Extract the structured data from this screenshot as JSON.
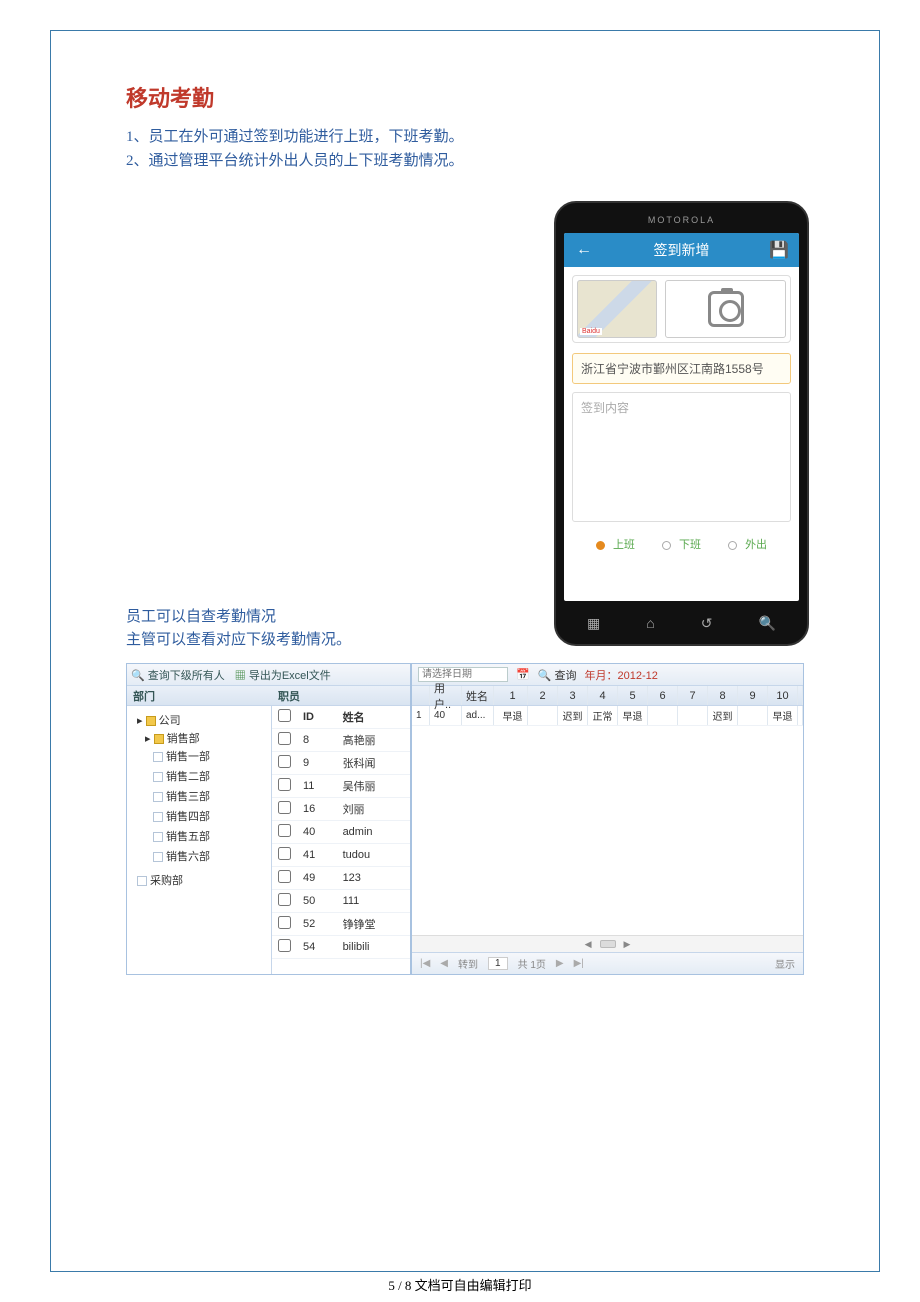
{
  "title": "移动考勤",
  "desc": {
    "line1": "1、员工在外可通过签到功能进行上班，下班考勤。",
    "line2": "2、通过管理平台统计外出人员的上下班考勤情况。"
  },
  "phone": {
    "brand": "MOTOROLA",
    "appbar_title": "签到新增",
    "address": "浙江省宁波市鄞州区江南路1558号",
    "content_placeholder": "签到内容",
    "radio_on": "上班",
    "radio_off": "下班",
    "radio_out": "外出"
  },
  "notes": {
    "line1": "员工可以自查考勤情况",
    "line2": "主管可以查看对应下级考勤情况。"
  },
  "toolbar": {
    "query_all": "查询下级所有人",
    "export": "导出为Excel文件"
  },
  "left_header": "部门",
  "emp_header": "职员",
  "tree": {
    "root": "公司",
    "sales": "销售部",
    "children": [
      "销售一部",
      "销售二部",
      "销售三部",
      "销售四部",
      "销售五部",
      "销售六部"
    ],
    "purchase": "采购部"
  },
  "emp_cols": {
    "id": "ID",
    "name": "姓名"
  },
  "employees": [
    {
      "id": "8",
      "name": "高艳丽"
    },
    {
      "id": "9",
      "name": "张科闻"
    },
    {
      "id": "11",
      "name": "吴伟丽"
    },
    {
      "id": "16",
      "name": "刘丽"
    },
    {
      "id": "40",
      "name": "admin"
    },
    {
      "id": "41",
      "name": "tudou"
    },
    {
      "id": "49",
      "name": "123"
    },
    {
      "id": "50",
      "name": "111"
    },
    {
      "id": "52",
      "name": "铮铮堂"
    },
    {
      "id": "54",
      "name": "bilibili"
    }
  ],
  "right": {
    "date_placeholder": "请选择日期",
    "query": "查询",
    "ym_label": "年月：",
    "ym_value": "2012-12",
    "cols": {
      "user": "用户..",
      "name": "姓名"
    },
    "days": [
      "1",
      "2",
      "3",
      "4",
      "5",
      "6",
      "7",
      "8",
      "9",
      "10"
    ],
    "row": {
      "rownum": "1",
      "userid": "40",
      "name": "ad...",
      "v1": "早退",
      "v3": "迟到",
      "v4": "正常",
      "v5": "早退",
      "v8": "迟到",
      "v10": "早退"
    },
    "pager": {
      "goto": "转到",
      "page_input": "1",
      "total_prefix": "共",
      "total_suffix": "1页",
      "display": "显示"
    }
  },
  "footer": "5 / 8 文档可自由编辑打印"
}
